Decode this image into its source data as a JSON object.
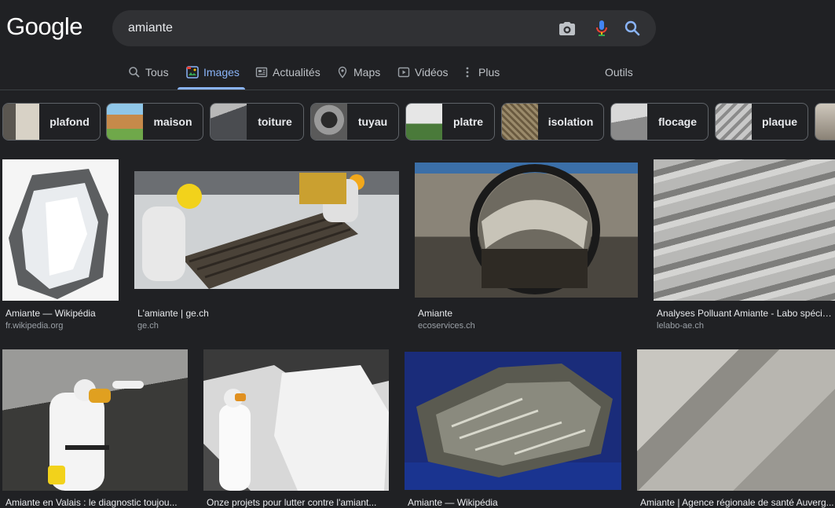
{
  "logo": "Google",
  "search": {
    "query": "amiante",
    "camera_icon": "camera-icon",
    "mic_icon": "microphone-icon",
    "search_icon": "search-icon"
  },
  "tabs": [
    {
      "label": "Tous",
      "icon": "search-icon"
    },
    {
      "label": "Images",
      "icon": "image-icon",
      "active": true
    },
    {
      "label": "Actualités",
      "icon": "news-icon"
    },
    {
      "label": "Maps",
      "icon": "map-pin-icon"
    },
    {
      "label": "Vidéos",
      "icon": "video-icon"
    },
    {
      "label": "Plus",
      "icon": "more-vert-icon"
    }
  ],
  "tools_label": "Outils",
  "chips": [
    {
      "label": "plafond"
    },
    {
      "label": "maison"
    },
    {
      "label": "toiture"
    },
    {
      "label": "tuyau"
    },
    {
      "label": "platre"
    },
    {
      "label": "isolation"
    },
    {
      "label": "flocage"
    },
    {
      "label": "plaque"
    }
  ],
  "results": [
    {
      "title": "Amiante — Wikipédia",
      "source": "fr.wikipedia.org"
    },
    {
      "title": "L'amiante | ge.ch",
      "source": "ge.ch"
    },
    {
      "title": "Amiante",
      "source": "ecoservices.ch"
    },
    {
      "title": "Analyses Polluant Amiante - Labo spécial...",
      "source": "lelabo-ae.ch"
    },
    {
      "title": "Amiante en Valais : le diagnostic toujou...",
      "source": ""
    },
    {
      "title": "Onze projets pour lutter contre l'amiant...",
      "source": ""
    },
    {
      "title": "Amiante — Wikipédia",
      "source": ""
    },
    {
      "title": "Amiante | Agence régionale de santé Auverg...",
      "source": ""
    }
  ],
  "colors": {
    "background": "#202124",
    "accent": "#8ab4f8",
    "searchbar": "#303134",
    "chip_border": "#5f6368"
  }
}
